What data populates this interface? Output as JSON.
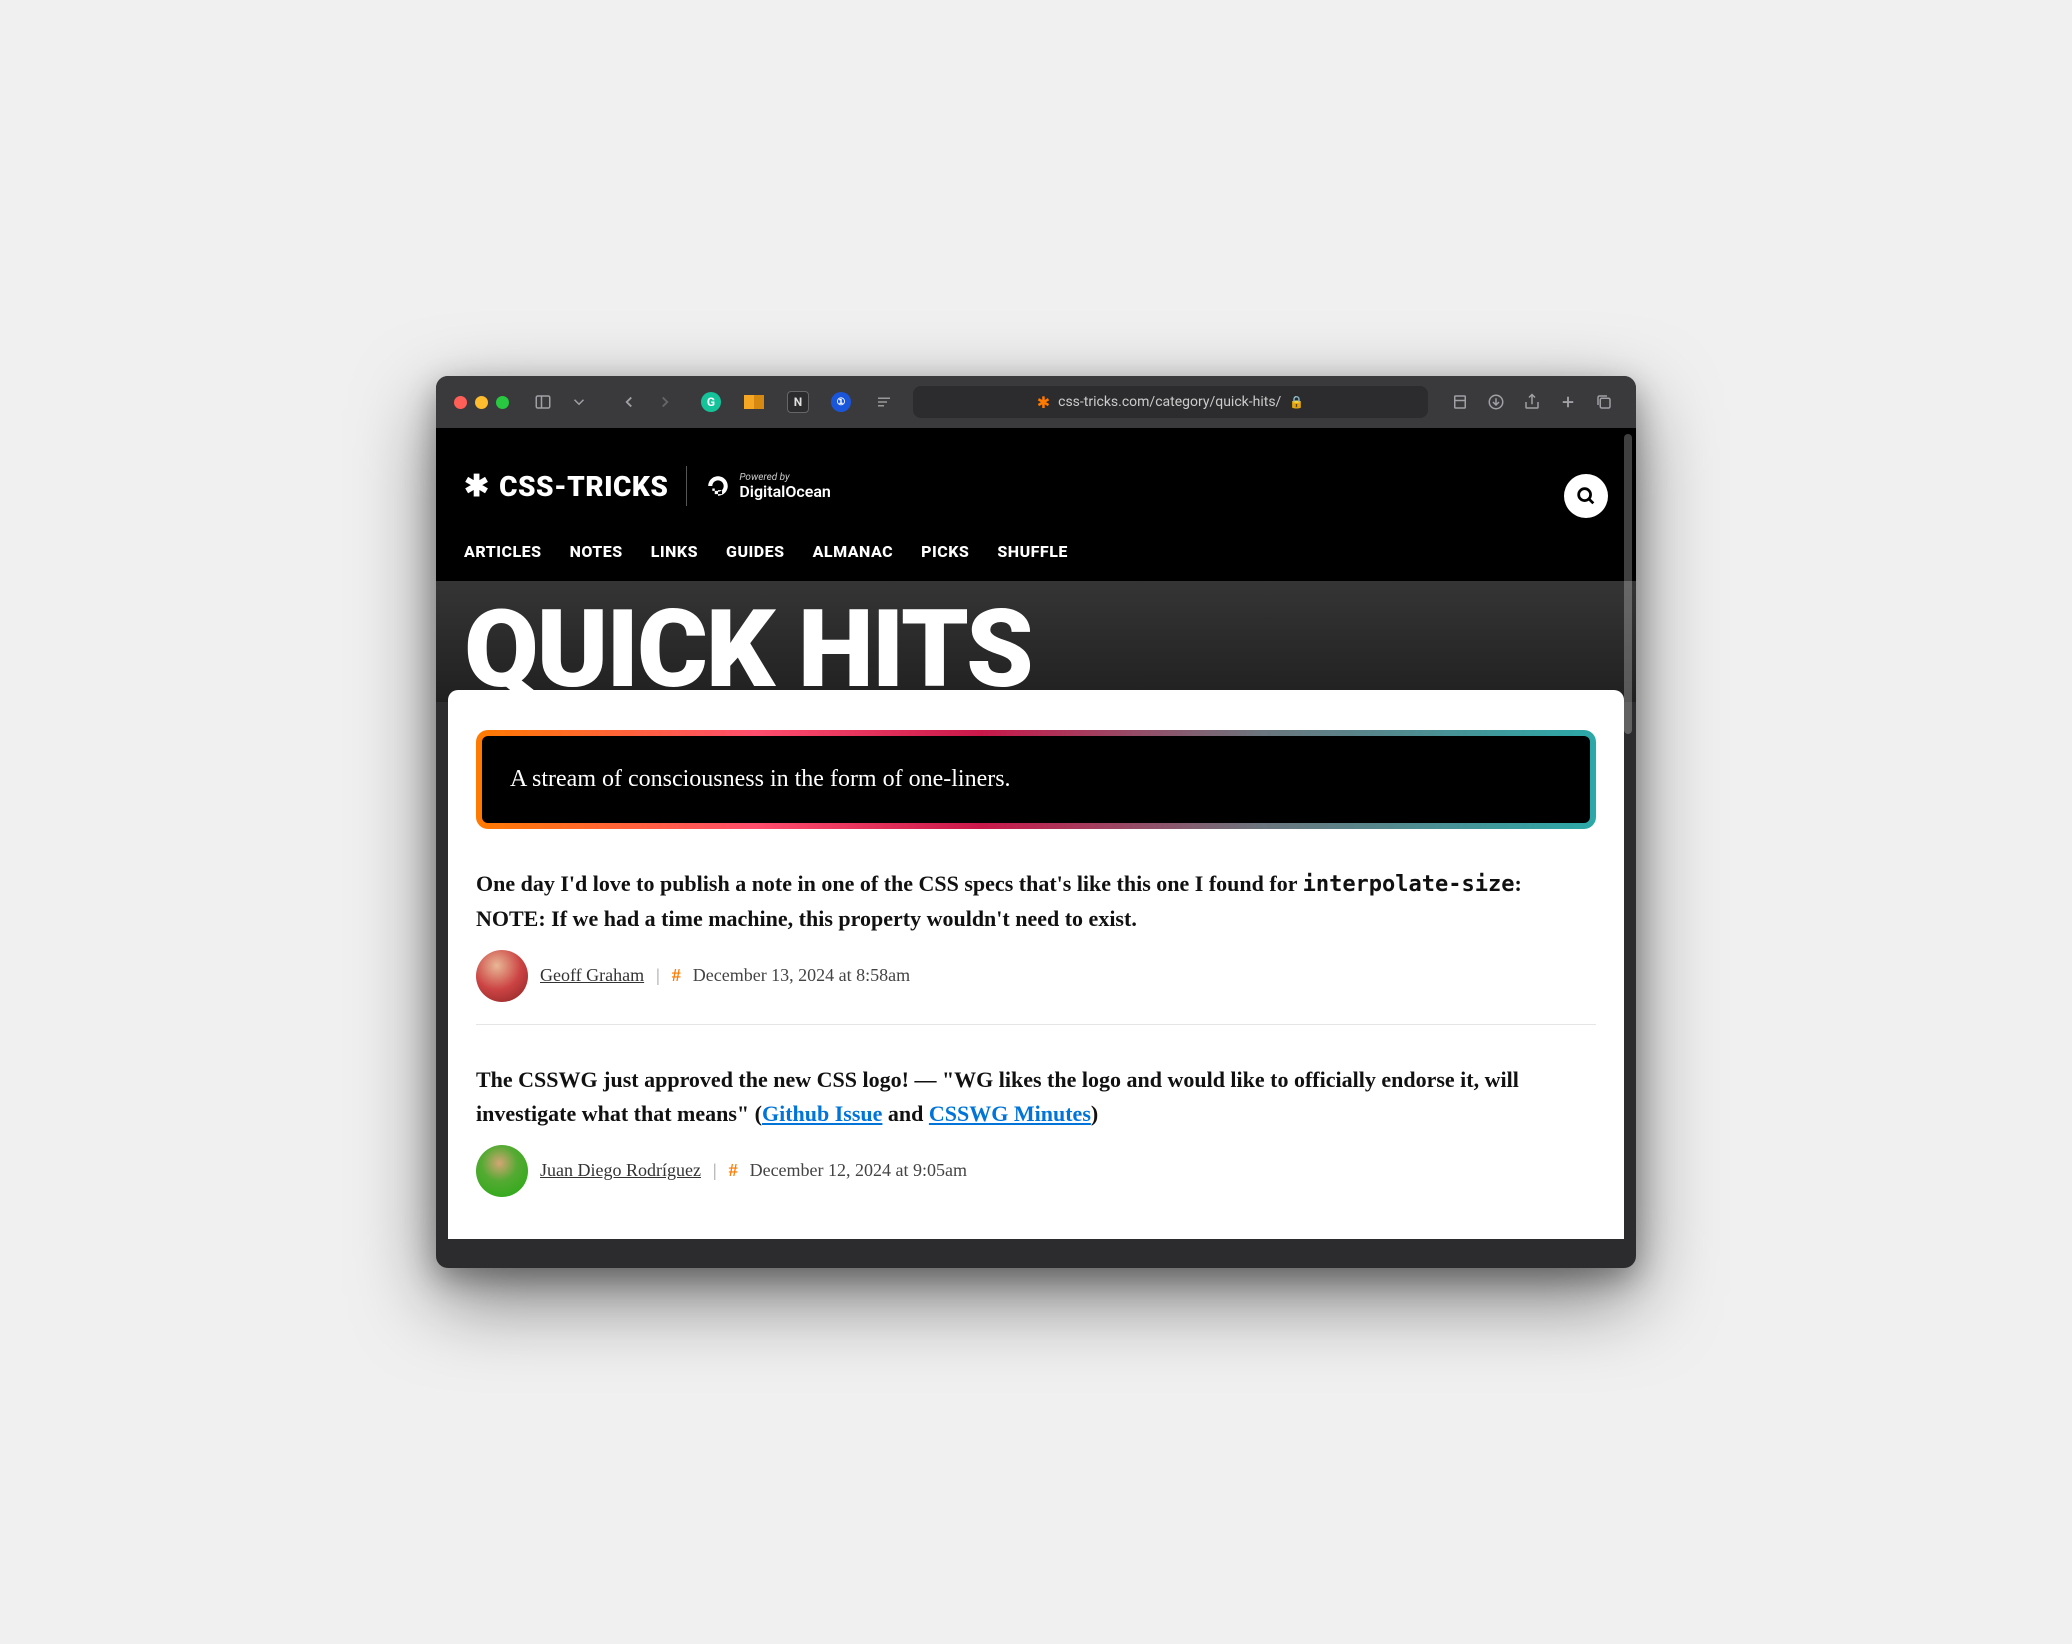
{
  "browser": {
    "url": "css-tricks.com/category/quick-hits/"
  },
  "site": {
    "logo_text": "CSS-TRICKS",
    "powered_small": "Powered by",
    "powered_big": "DigitalOcean"
  },
  "nav": [
    "ARTICLES",
    "NOTES",
    "LINKS",
    "GUIDES",
    "ALMANAC",
    "PICKS",
    "SHUFFLE"
  ],
  "hero": {
    "title": "QUICK HITS"
  },
  "description": "A stream of consciousness in the form of one-liners.",
  "posts": [
    {
      "body_prefix": "One day I'd love to publish a note in one of the CSS specs that's like this one I found for ",
      "code": "interpolate-size",
      "body_suffix": ": NOTE: If we had a time machine, this property wouldn't need to exist.",
      "author": "Geoff Graham",
      "hash": "#",
      "date": "December 13, 2024 at 8:58am",
      "avatar_class": "geoff"
    },
    {
      "body_prefix": "The CSSWG just approved the new CSS logo! — \"WG likes the logo and would like to officially endorse it, will investigate what that means\" (",
      "link1": "Github Issue",
      "mid": " and ",
      "link2": "CSSWG Minutes",
      "body_suffix": ")",
      "author": "Juan Diego Rodríguez",
      "hash": "#",
      "date": "December 12, 2024 at 9:05am",
      "avatar_class": "juan"
    }
  ]
}
